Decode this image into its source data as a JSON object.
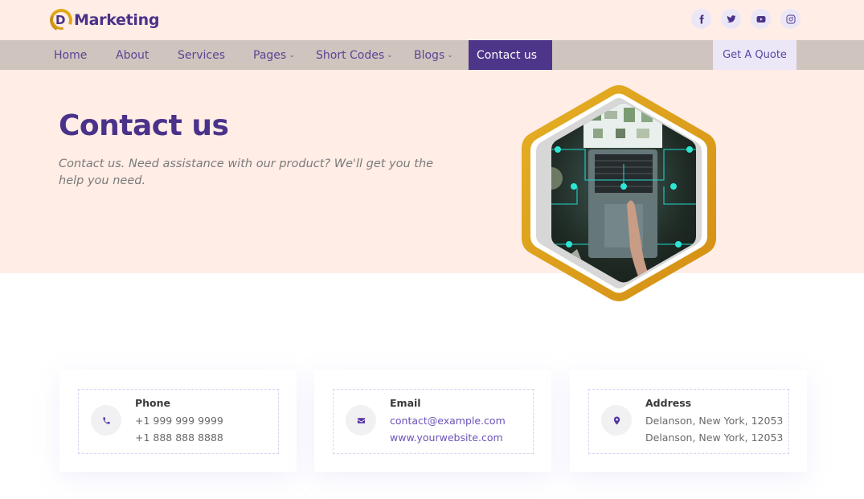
{
  "brand": {
    "logo_letter": "D",
    "name": "Marketing"
  },
  "socials": [
    {
      "name": "facebook-icon"
    },
    {
      "name": "twitter-icon"
    },
    {
      "name": "youtube-icon"
    },
    {
      "name": "instagram-icon"
    }
  ],
  "nav": {
    "items": [
      {
        "label": "Home",
        "dropdown": false
      },
      {
        "label": "About",
        "dropdown": false
      },
      {
        "label": "Services",
        "dropdown": false
      },
      {
        "label": "Pages",
        "dropdown": true
      },
      {
        "label": "Short Codes",
        "dropdown": true
      },
      {
        "label": "Blogs",
        "dropdown": true
      },
      {
        "label": "Contact us",
        "dropdown": false,
        "active": true
      }
    ],
    "chevron": "⌄",
    "quote_button": "Get A Quote"
  },
  "hero": {
    "title": "Contact us",
    "subtitle": "Contact us. Need assistance with our product? We'll get you the help you need.",
    "image_alt": "Laptop with network connection icons"
  },
  "cards": [
    {
      "icon": "phone-icon",
      "title": "Phone",
      "lines": [
        "+1 999 999 9999",
        "+1 888 888 8888"
      ],
      "links": false
    },
    {
      "icon": "envelope-icon",
      "title": "Email",
      "lines": [
        "contact@example.com",
        "www.yourwebsite.com"
      ],
      "links": true
    },
    {
      "icon": "map-pin-icon",
      "title": "Address",
      "lines": [
        "Delanson, New York, 12053",
        "Delanson, New York, 12053"
      ],
      "links": false
    }
  ],
  "colors": {
    "brand_purple": "#4b3289",
    "accent_gold": "#e0a818",
    "hero_bg": "#ffede6",
    "nav_bg": "#d0c4be"
  }
}
